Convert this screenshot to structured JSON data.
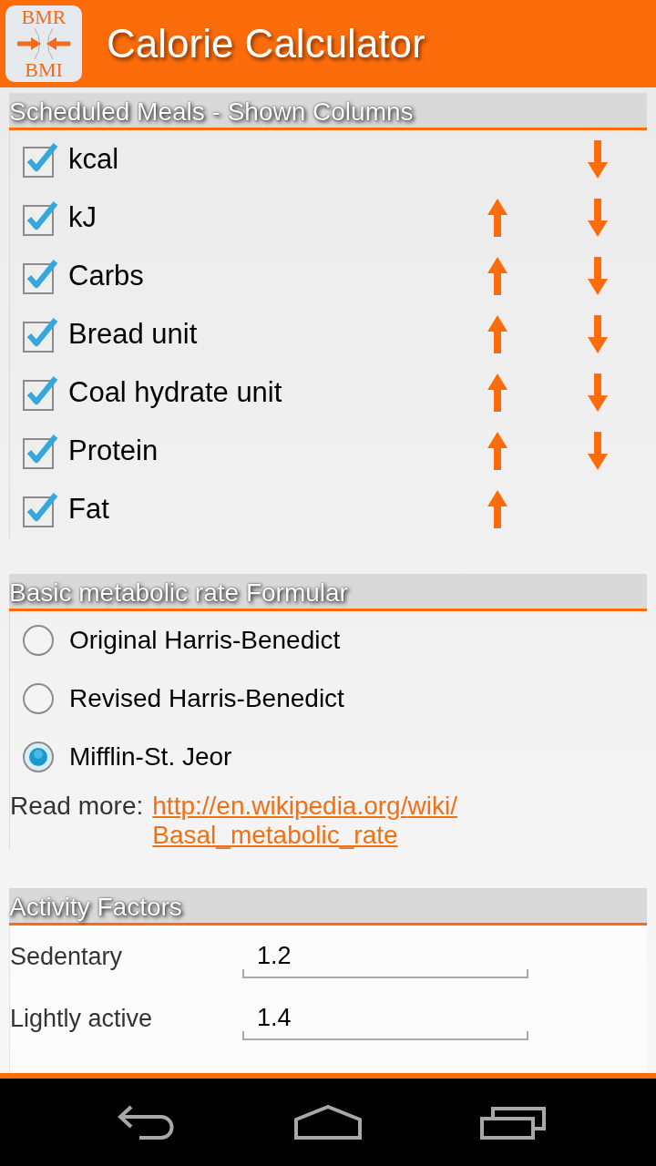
{
  "app_bar": {
    "logo_top": "BMR",
    "logo_bottom": "BMI",
    "title": "Calorie Calculator"
  },
  "shown_columns": {
    "title": "Scheduled Meals - Shown Columns",
    "items": [
      {
        "label": "kcal",
        "checked": true,
        "move_up": false,
        "move_down": true
      },
      {
        "label": "kJ",
        "checked": true,
        "move_up": true,
        "move_down": true
      },
      {
        "label": "Carbs",
        "checked": true,
        "move_up": true,
        "move_down": true
      },
      {
        "label": "Bread unit",
        "checked": true,
        "move_up": true,
        "move_down": true
      },
      {
        "label": "Coal hydrate unit",
        "checked": true,
        "move_up": true,
        "move_down": true
      },
      {
        "label": "Protein",
        "checked": true,
        "move_up": true,
        "move_down": true
      },
      {
        "label": "Fat",
        "checked": true,
        "move_up": true,
        "move_down": false
      }
    ]
  },
  "bmr_formula": {
    "title": "Basic metabolic rate Formular",
    "options": [
      {
        "label": "Original Harris-Benedict",
        "selected": false
      },
      {
        "label": "Revised Harris-Benedict",
        "selected": false
      },
      {
        "label": "Mifflin-St. Jeor",
        "selected": true
      }
    ],
    "read_more_label": "Read more:",
    "read_more_link": "http://en.wikipedia.org/wiki/Basal_metabolic_rate"
  },
  "activity_factors": {
    "title": "Activity Factors",
    "rows": [
      {
        "label": "Sedentary",
        "value": "1.2"
      },
      {
        "label": "Lightly active",
        "value": "1.4"
      }
    ]
  }
}
